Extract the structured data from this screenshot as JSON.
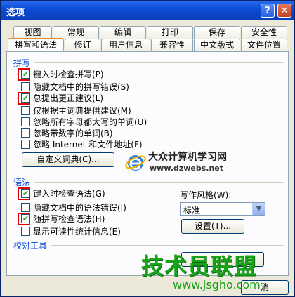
{
  "window": {
    "title": "选项",
    "help_glyph": "?",
    "close_glyph": "✕"
  },
  "tabs_row1": [
    "视图",
    "常规",
    "编辑",
    "打印",
    "保存",
    "安全性"
  ],
  "tabs_row2": [
    "拼写和语法",
    "修订",
    "用户信息",
    "兼容性",
    "中文版式",
    "文件位置"
  ],
  "active_tab": "拼写和语法",
  "spelling": {
    "title": "拼写",
    "options": [
      {
        "label": "键入时检查拼写(P)",
        "checked": true,
        "highlighted": true
      },
      {
        "label": "隐藏文档中的拼写错误(S)",
        "checked": false,
        "highlighted": false
      },
      {
        "label": "总提出更正建议(L)",
        "checked": true,
        "highlighted": true
      },
      {
        "label": "仅根据主词典提供建议(M)",
        "checked": false,
        "highlighted": false
      },
      {
        "label": "忽略所有字母都大写的单词(U)",
        "checked": false,
        "highlighted": false
      },
      {
        "label": "忽略带数字的单词(B)",
        "checked": false,
        "highlighted": false
      },
      {
        "label": "忽略 Internet 和文件地址(F)",
        "checked": false,
        "highlighted": false
      }
    ],
    "dict_button": "自定义词典(C)..."
  },
  "grammar": {
    "title": "语法",
    "options": [
      {
        "label": "键入时检查语法(G)",
        "checked": true,
        "highlighted": true
      },
      {
        "label": "隐藏文档中的语法错误(I)",
        "checked": false,
        "highlighted": false
      },
      {
        "label": "随拼写检查语法(H)",
        "checked": true,
        "highlighted": true
      },
      {
        "label": "显示可读性统计信息(E)",
        "checked": false,
        "highlighted": false
      }
    ],
    "style_label": "写作风格(W):",
    "style_value": "标准",
    "settings_button": "设置(T)..."
  },
  "proofing": {
    "title": "校对工具"
  },
  "footer": {
    "cancel_button": "消"
  },
  "watermark": {
    "brand": "大众计算机学习网",
    "url": "www.dzwebs.net",
    "brand2": "技术员联盟",
    "url2": "www.jsgho.com"
  },
  "colors": {
    "title_bar": "#0c4cd6",
    "section_title": "#0046d5",
    "highlight": "#e00000",
    "check": "#21a121"
  }
}
